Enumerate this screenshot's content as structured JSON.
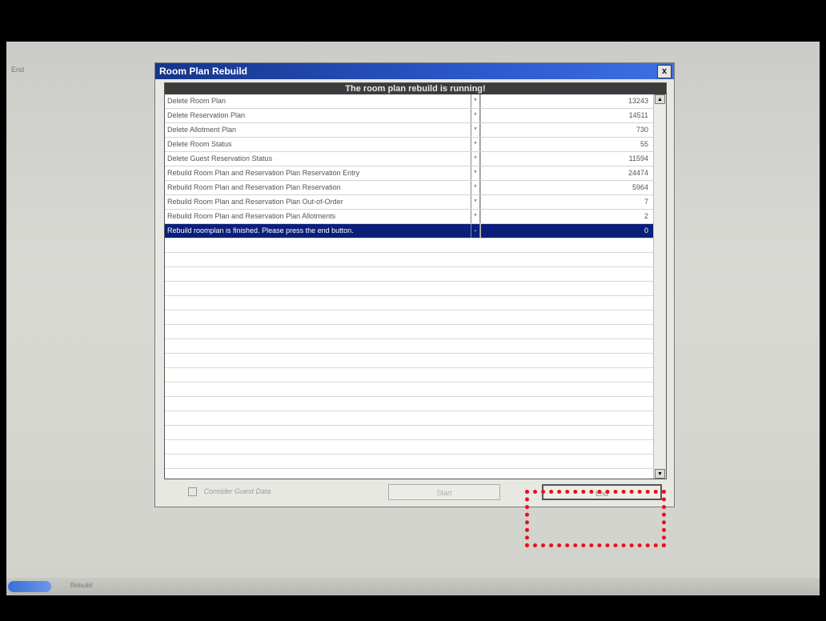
{
  "screen": {
    "label": "End"
  },
  "dialog": {
    "title": "Room Plan Rebuild",
    "close_label": "x",
    "header": "The room plan rebuild is running!",
    "rows": [
      {
        "description": "Delete Room Plan",
        "mark": "*",
        "count": "13243"
      },
      {
        "description": "Delete Reservation Plan",
        "mark": "*",
        "count": "14511"
      },
      {
        "description": "Delete Allotment Plan",
        "mark": "*",
        "count": "730"
      },
      {
        "description": "Delete Room Status",
        "mark": "*",
        "count": "55"
      },
      {
        "description": "Delete Guest Reservation Status",
        "mark": "*",
        "count": "11594"
      },
      {
        "description": "Rebuild Room Plan and Reservation Plan Reservation Entry",
        "mark": "*",
        "count": "24474"
      },
      {
        "description": "Rebuild Room Plan and Reservation Plan Reservation",
        "mark": "*",
        "count": "5964"
      },
      {
        "description": "Rebuild Room Plan and Reservation Plan Out-of-Order",
        "mark": "*",
        "count": "7"
      },
      {
        "description": "Rebuild Room Plan and Reservation Plan Allotments",
        "mark": "*",
        "count": "2"
      },
      {
        "description": "Rebuild roomplan is finished. Please press the end button.",
        "mark": "-",
        "count": "0",
        "selected": true
      }
    ],
    "checkbox_label": "Consider Guest Data",
    "start_label": "Start",
    "end_label": "End"
  },
  "taskbar": {
    "item": "Rebuild"
  },
  "colors": {
    "titlebar": "#2b57c9",
    "selection": "#0a1f7a",
    "highlight": "#e8101a"
  }
}
